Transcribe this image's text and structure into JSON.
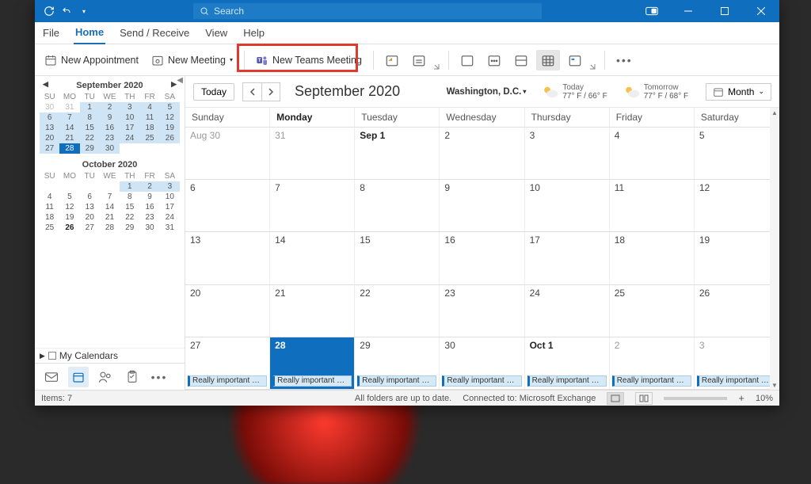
{
  "titlebar": {
    "search_placeholder": "Search"
  },
  "menu": {
    "tabs": [
      "File",
      "Home",
      "Send / Receive",
      "View",
      "Help"
    ],
    "active": 1
  },
  "ribbon": {
    "new_appointment": "New Appointment",
    "new_meeting": "New Meeting",
    "new_teams_meeting": "New Teams Meeting"
  },
  "minicals": [
    {
      "title": "September 2020",
      "dow": [
        "SU",
        "MO",
        "TU",
        "WE",
        "TH",
        "FR",
        "SA"
      ],
      "rows": [
        [
          {
            "n": 30,
            "dim": true
          },
          {
            "n": 31,
            "dim": true
          },
          {
            "n": 1,
            "range": true
          },
          {
            "n": 2,
            "range": true
          },
          {
            "n": 3,
            "range": true
          },
          {
            "n": 4,
            "range": true
          },
          {
            "n": 5,
            "range": true
          }
        ],
        [
          {
            "n": 6,
            "range": true
          },
          {
            "n": 7,
            "range": true
          },
          {
            "n": 8,
            "range": true
          },
          {
            "n": 9,
            "range": true
          },
          {
            "n": 10,
            "range": true
          },
          {
            "n": 11,
            "range": true
          },
          {
            "n": 12,
            "range": true
          }
        ],
        [
          {
            "n": 13,
            "range": true
          },
          {
            "n": 14,
            "range": true
          },
          {
            "n": 15,
            "range": true
          },
          {
            "n": 16,
            "range": true
          },
          {
            "n": 17,
            "range": true
          },
          {
            "n": 18,
            "range": true
          },
          {
            "n": 19,
            "range": true
          }
        ],
        [
          {
            "n": 20,
            "range": true
          },
          {
            "n": 21,
            "range": true
          },
          {
            "n": 22,
            "range": true
          },
          {
            "n": 23,
            "range": true
          },
          {
            "n": 24,
            "range": true
          },
          {
            "n": 25,
            "range": true
          },
          {
            "n": 26,
            "range": true
          }
        ],
        [
          {
            "n": 27,
            "range": true
          },
          {
            "n": 28,
            "sel": true
          },
          {
            "n": 29,
            "range": true
          },
          {
            "n": 30,
            "range": true
          },
          {
            "n": "",
            "dim": true
          },
          {
            "n": "",
            "dim": true
          },
          {
            "n": "",
            "dim": true
          }
        ]
      ]
    },
    {
      "title": "October 2020",
      "dow": [
        "SU",
        "MO",
        "TU",
        "WE",
        "TH",
        "FR",
        "SA"
      ],
      "rows": [
        [
          {
            "n": "",
            "dim": true
          },
          {
            "n": "",
            "dim": true
          },
          {
            "n": "",
            "dim": true
          },
          {
            "n": "",
            "dim": true
          },
          {
            "n": 1,
            "range": true
          },
          {
            "n": 2,
            "range": true
          },
          {
            "n": 3,
            "range": true
          }
        ],
        [
          {
            "n": 4
          },
          {
            "n": 5
          },
          {
            "n": 6
          },
          {
            "n": 7
          },
          {
            "n": 8
          },
          {
            "n": 9
          },
          {
            "n": 10
          }
        ],
        [
          {
            "n": 11
          },
          {
            "n": 12
          },
          {
            "n": 13
          },
          {
            "n": 14
          },
          {
            "n": 15
          },
          {
            "n": 16
          },
          {
            "n": 17
          }
        ],
        [
          {
            "n": 18
          },
          {
            "n": 19
          },
          {
            "n": 20
          },
          {
            "n": 21
          },
          {
            "n": 22
          },
          {
            "n": 23
          },
          {
            "n": 24
          }
        ],
        [
          {
            "n": 25
          },
          {
            "n": 26,
            "bold": true
          },
          {
            "n": 27
          },
          {
            "n": 28
          },
          {
            "n": 29
          },
          {
            "n": 30
          },
          {
            "n": 31
          }
        ]
      ]
    }
  ],
  "my_calendars_label": "My Calendars",
  "calheader": {
    "today": "Today",
    "title": "September 2020",
    "location": "Washington, D.C.",
    "today_label": "Today",
    "today_temp": "77° F / 66° F",
    "tomorrow_label": "Tomorrow",
    "tomorrow_temp": "77° F / 68° F",
    "view": "Month"
  },
  "dow": [
    {
      "t": "Sunday"
    },
    {
      "t": "Monday",
      "bold": true
    },
    {
      "t": "Tuesday"
    },
    {
      "t": "Wednesday"
    },
    {
      "t": "Thursday"
    },
    {
      "t": "Friday"
    },
    {
      "t": "Saturday"
    }
  ],
  "weeks": [
    [
      {
        "t": "Aug 30",
        "dim": true
      },
      {
        "t": "31",
        "dim": true
      },
      {
        "t": "Sep 1",
        "bold": true
      },
      {
        "t": "2"
      },
      {
        "t": "3"
      },
      {
        "t": "4"
      },
      {
        "t": "5"
      }
    ],
    [
      {
        "t": "6"
      },
      {
        "t": "7"
      },
      {
        "t": "8"
      },
      {
        "t": "9"
      },
      {
        "t": "10"
      },
      {
        "t": "11"
      },
      {
        "t": "12"
      }
    ],
    [
      {
        "t": "13"
      },
      {
        "t": "14"
      },
      {
        "t": "15"
      },
      {
        "t": "16"
      },
      {
        "t": "17"
      },
      {
        "t": "18"
      },
      {
        "t": "19"
      }
    ],
    [
      {
        "t": "20"
      },
      {
        "t": "21"
      },
      {
        "t": "22"
      },
      {
        "t": "23"
      },
      {
        "t": "24"
      },
      {
        "t": "25"
      },
      {
        "t": "26"
      }
    ],
    [
      {
        "t": "27",
        "ev": "Really important m…"
      },
      {
        "t": "28",
        "sel": true,
        "ev": "Really important m…"
      },
      {
        "t": "29",
        "ev": "Really important m…"
      },
      {
        "t": "30",
        "ev": "Really important m…"
      },
      {
        "t": "Oct 1",
        "bold": true,
        "ev": "Really important m…"
      },
      {
        "t": "2",
        "dim": true,
        "ev": "Really important m…"
      },
      {
        "t": "3",
        "dim": true,
        "ev": "Really important m…"
      }
    ]
  ],
  "status": {
    "items": "Items: 7",
    "sync": "All folders are up to date.",
    "conn": "Connected to: Microsoft Exchange",
    "zoom": "10%"
  }
}
